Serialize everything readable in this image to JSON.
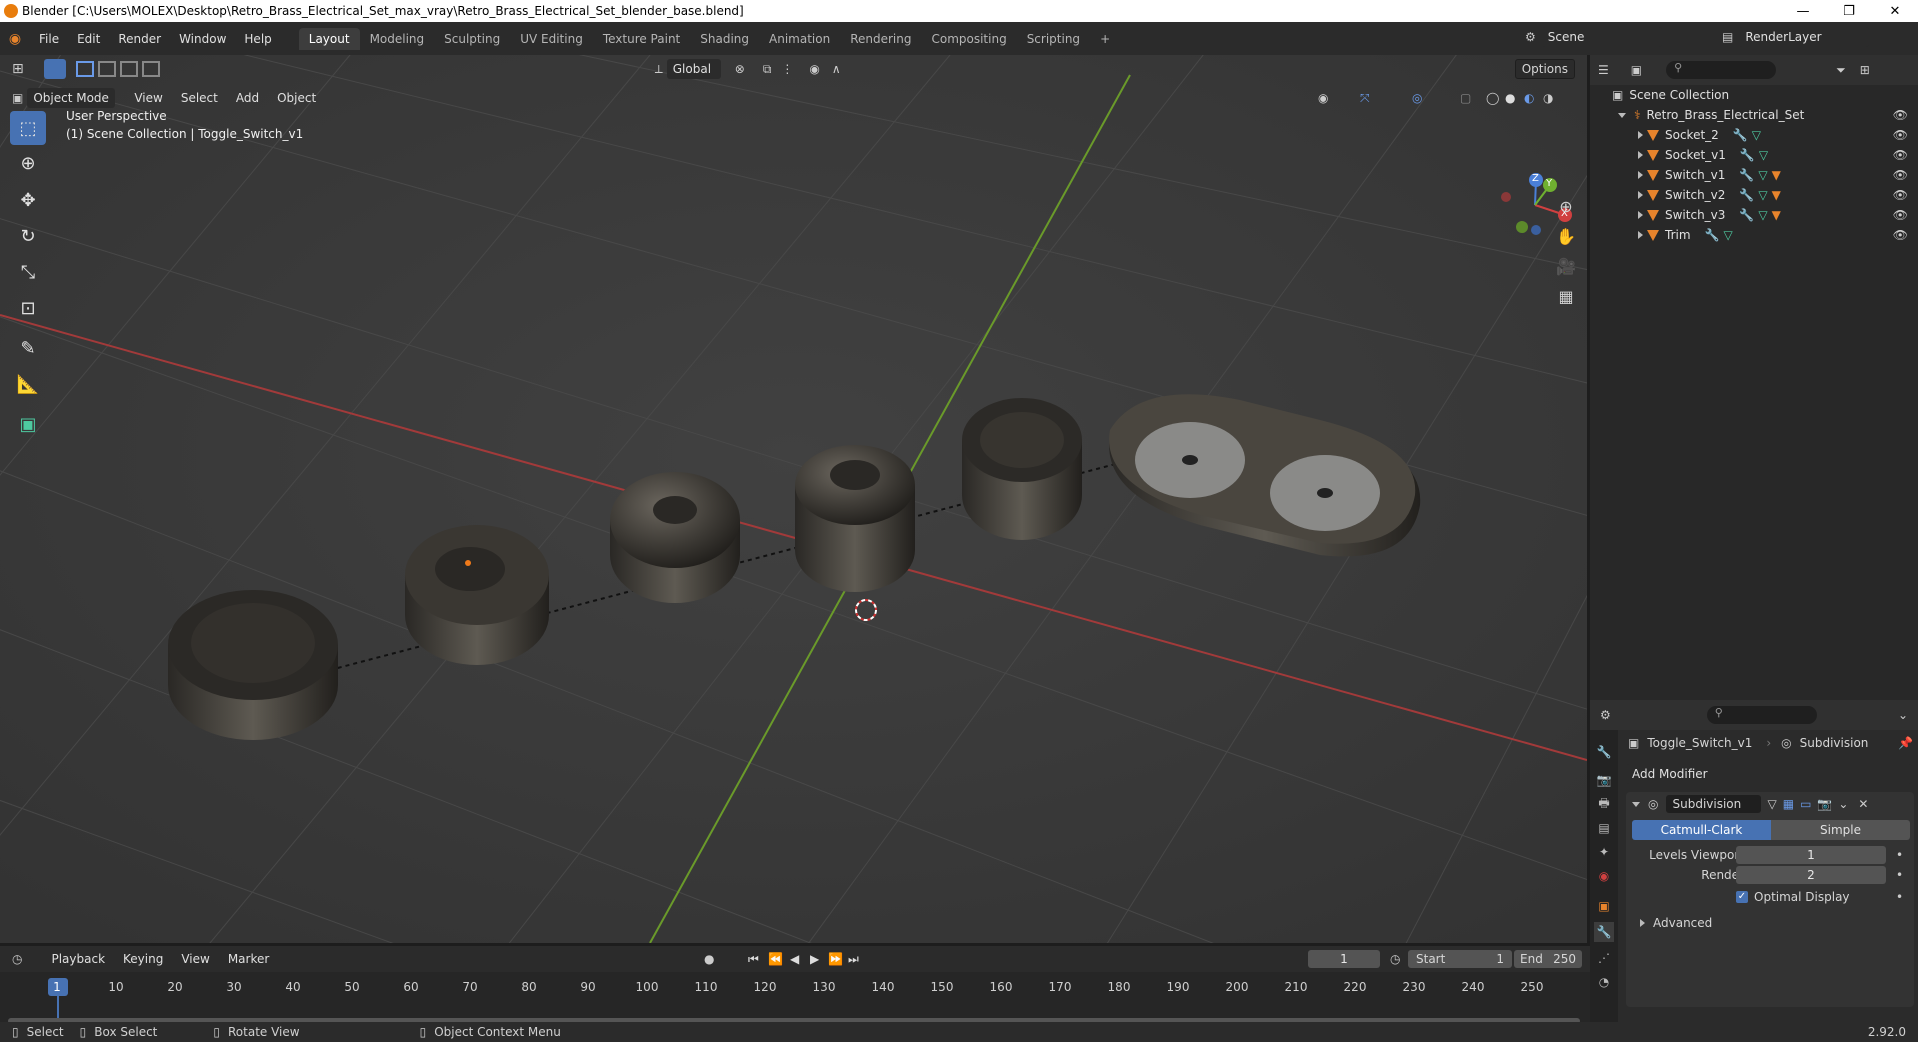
{
  "window": {
    "title": "Blender [C:\\Users\\MOLEX\\Desktop\\Retro_Brass_Electrical_Set_max_vray\\Retro_Brass_Electrical_Set_blender_base.blend]",
    "minimize": "—",
    "maximize": "❐",
    "close": "✕"
  },
  "menu": {
    "items": [
      "File",
      "Edit",
      "Render",
      "Window",
      "Help"
    ],
    "workspaces": [
      "Layout",
      "Modeling",
      "Sculpting",
      "UV Editing",
      "Texture Paint",
      "Shading",
      "Animation",
      "Rendering",
      "Compositing",
      "Scripting"
    ],
    "active_workspace": "Layout",
    "add_workspace": "+",
    "scene_label": "Scene",
    "renderlayer_label": "RenderLayer"
  },
  "viewport": {
    "mode": "Object Mode",
    "menus": [
      "View",
      "Select",
      "Add",
      "Object"
    ],
    "transform_orientation": "Global",
    "options": "Options",
    "perspective": "User Perspective",
    "collection_info": "(1) Scene Collection | Toggle_Switch_v1",
    "gizmo": {
      "z": "Z",
      "y": "Y",
      "x": "X"
    }
  },
  "outliner": {
    "root": "Scene Collection",
    "collection": "Retro_Brass_Electrical_Set",
    "objects": [
      "Socket_2",
      "Socket_v1",
      "Switch_v1",
      "Switch_v2",
      "Switch_v3",
      "Trim"
    ]
  },
  "properties": {
    "object_name": "Toggle_Switch_v1",
    "modifier_breadcrumb": "Subdivision",
    "add_modifier": "Add Modifier",
    "modifier_name": "Subdivision",
    "type_catmull": "Catmull-Clark",
    "type_simple": "Simple",
    "levels_viewport_label": "Levels Viewport",
    "levels_viewport_value": "1",
    "render_label": "Render",
    "render_value": "2",
    "optimal_display": "Optimal Display",
    "advanced": "Advanced"
  },
  "timeline": {
    "menus": [
      "Playback",
      "Keying",
      "View",
      "Marker"
    ],
    "current_frame": "1",
    "start_label": "Start",
    "start_value": "1",
    "end_label": "End",
    "end_value": "250",
    "ticks": [
      "1",
      "10",
      "20",
      "30",
      "40",
      "50",
      "60",
      "70",
      "80",
      "90",
      "100",
      "110",
      "120",
      "130",
      "140",
      "150",
      "160",
      "170",
      "180",
      "190",
      "200",
      "210",
      "220",
      "230",
      "240",
      "250"
    ]
  },
  "status": {
    "select": "Select",
    "box_select": "Box Select",
    "rotate_view": "Rotate View",
    "context_menu": "Object Context Menu",
    "version": "2.92.0"
  }
}
